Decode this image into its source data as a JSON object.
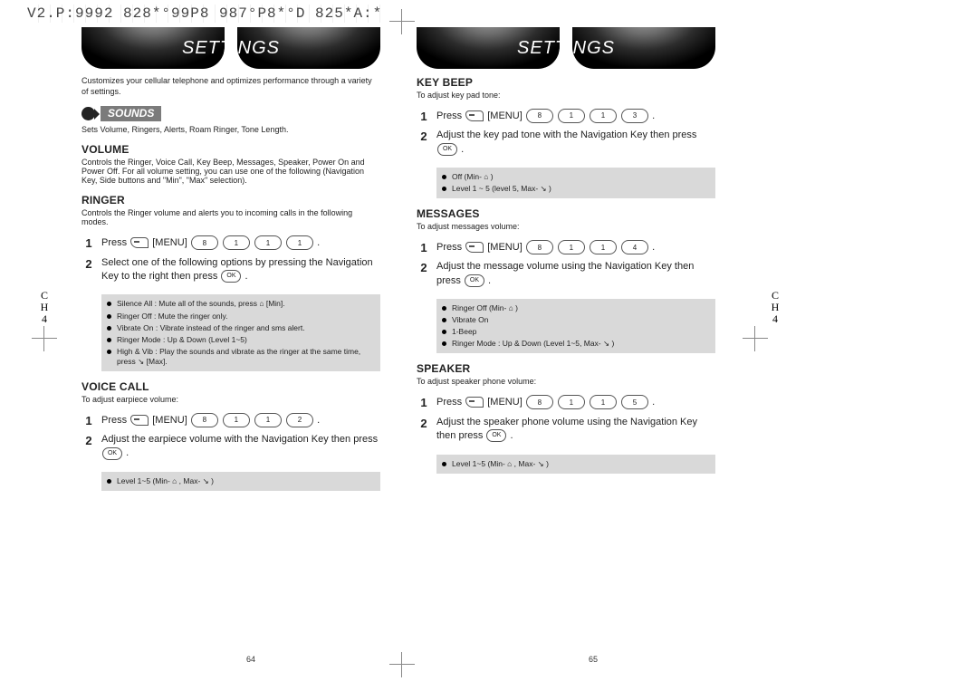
{
  "meta_header": "V2.P:9992 828*°99P8 987°P8*°D 825*A:*",
  "side_label": "C\nH",
  "side_num": "4",
  "page_left_num": "64",
  "page_right_num": "65",
  "settings_title": "SETTINGS",
  "left": {
    "intro": "Customizes your cellular telephone and optimizes performance through a variety of settings.",
    "group_label": "SOUNDS",
    "group_sub": "Sets Volume, Ringers, Alerts, Roam Ringer, Tone Length.",
    "volume": {
      "title": "VOLUME",
      "sub": "Controls the Ringer, Voice Call, Key Beep, Messages, Speaker, Power On and Power Off. For all volume setting, you can use one of the following (Navigation Key, Side buttons and \"Min\", \"Max\" selection)."
    },
    "ringer": {
      "title": "RINGER",
      "sub": "Controls the Ringer volume and alerts you to incoming calls in the following modes.",
      "step1_a": "Press ",
      "step1_b": " [MENU] ",
      "step1_keys": [
        "8",
        "1",
        "1",
        "1"
      ],
      "step1_end": " .",
      "step2_a": "Select one of the following options by pressing the Navigation Key to the right then press ",
      "step2_end": " .",
      "notes": [
        "Silence All : Mute all of the sounds, press ⌂ [Min].",
        "Ringer Off : Mute the ringer only.",
        "Vibrate On : Vibrate instead of the ringer and sms alert.",
        "Ringer Mode : Up & Down (Level 1~5)",
        "High & Vib : Play the sounds and vibrate as the ringer at the same time, press ↘ [Max]."
      ]
    },
    "voicecall": {
      "title": "VOICE CALL",
      "sub": "To adjust earpiece volume:",
      "step1_a": "Press ",
      "step1_b": " [MENU] ",
      "step1_keys": [
        "8",
        "1",
        "1",
        "2"
      ],
      "step1_end": " .",
      "step2_a": "Adjust the earpiece volume with the Navigation Key then press ",
      "step2_end": " .",
      "notes": [
        "Level 1~5 (Min- ⌂ , Max- ↘ )"
      ]
    }
  },
  "right": {
    "keybeep": {
      "title": "KEY BEEP",
      "sub": "To adjust key pad tone:",
      "step1_a": "Press ",
      "step1_b": " [MENU] ",
      "step1_keys": [
        "8",
        "1",
        "1",
        "3"
      ],
      "step1_end": " .",
      "step2_a": "Adjust the key pad tone with the Navigation Key then press ",
      "step2_end": " .",
      "notes": [
        "Off (Min- ⌂ )",
        "Level 1 ~ 5 (level 5, Max- ↘ )"
      ]
    },
    "messages": {
      "title": "MESSAGES",
      "sub": "To adjust messages volume:",
      "step1_a": "Press ",
      "step1_b": " [MENU] ",
      "step1_keys": [
        "8",
        "1",
        "1",
        "4"
      ],
      "step1_end": " .",
      "step2_a": "Adjust the message volume using the Navigation Key then press ",
      "step2_end": " .",
      "notes": [
        "Ringer Off (Min- ⌂ )",
        "Vibrate On",
        "1-Beep",
        "Ringer Mode : Up & Down (Level 1~5, Max- ↘ )"
      ]
    },
    "speaker": {
      "title": "SPEAKER",
      "sub": "To adjust speaker phone volume:",
      "step1_a": "Press ",
      "step1_b": " [MENU] ",
      "step1_keys": [
        "8",
        "1",
        "1",
        "5"
      ],
      "step1_end": " .",
      "step2_a": "Adjust the speaker phone volume using the Navigation Key then press ",
      "step2_end": " .",
      "notes": [
        "Level 1~5 (Min- ⌂ , Max- ↘ )"
      ]
    }
  },
  "ok_label": "OK"
}
